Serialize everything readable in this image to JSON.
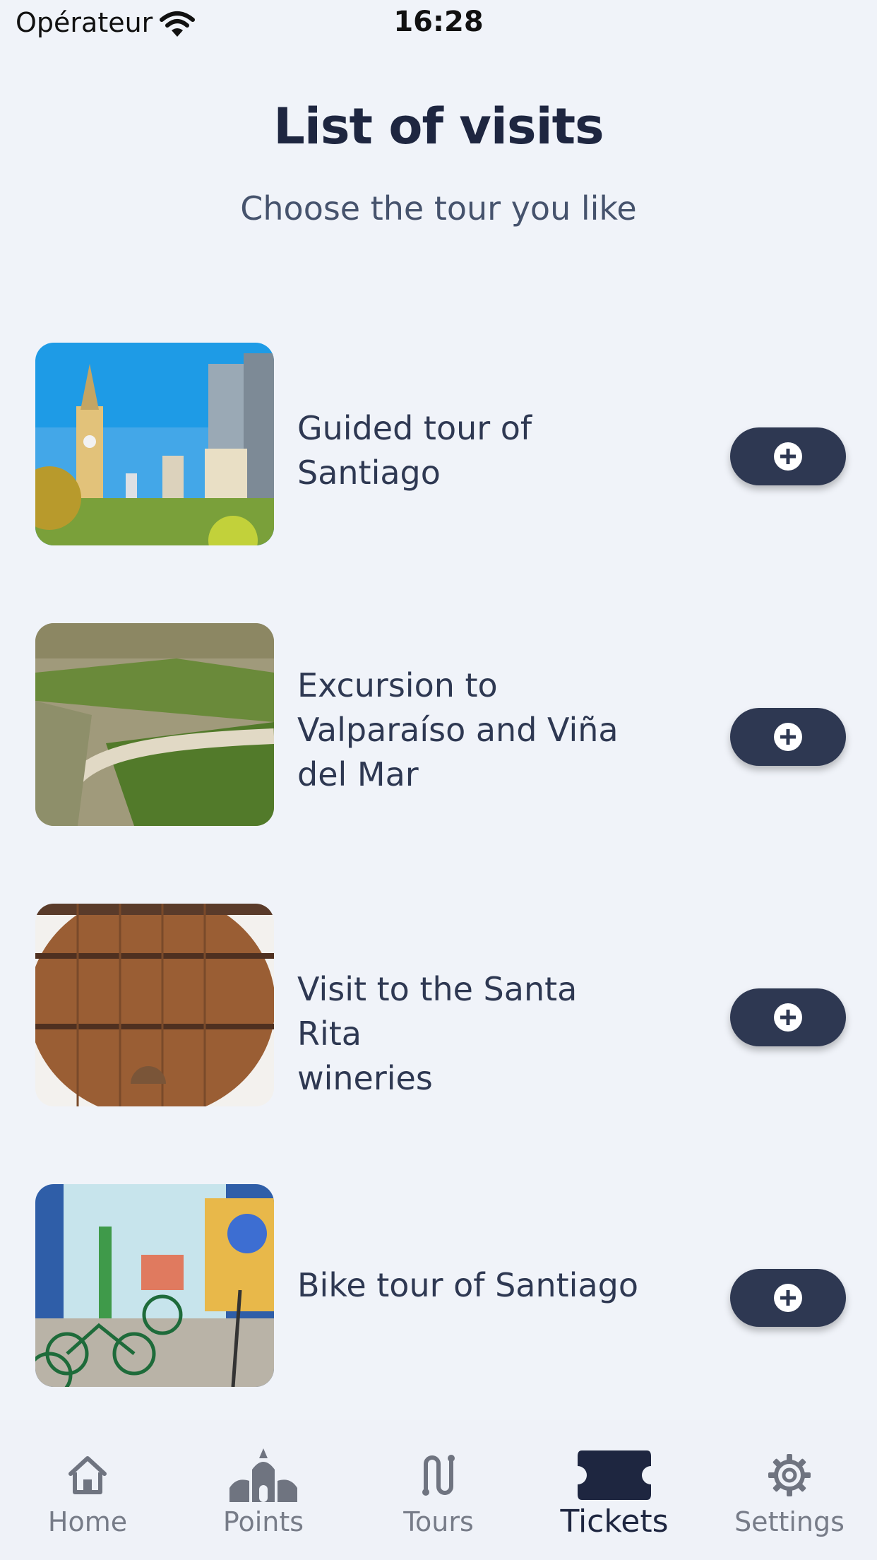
{
  "status_bar": {
    "carrier": "Opérateur",
    "time": "16:28"
  },
  "header": {
    "title": "List of visits",
    "subtitle": "Choose the tour you like"
  },
  "tours": [
    {
      "name_line1": "Guided tour of",
      "name_line2": "Santiago",
      "name_line3": ""
    },
    {
      "name_line1": "Excursion to",
      "name_line2": "Valparaíso and Viña",
      "name_line3": "del Mar"
    },
    {
      "name_line1": "Visit to the Santa Rita",
      "name_line2": "wineries",
      "name_line3": ""
    },
    {
      "name_line1": "Bike tour of Santiago",
      "name_line2": "",
      "name_line3": ""
    }
  ],
  "tab_bar": {
    "active": "Tickets",
    "tabs": [
      {
        "label": "Home",
        "icon": "home-icon"
      },
      {
        "label": "Points",
        "icon": "church-icon"
      },
      {
        "label": "Tours",
        "icon": "route-icon"
      },
      {
        "label": "Tickets",
        "icon": "ticket-icon"
      },
      {
        "label": "Settings",
        "icon": "gear-icon"
      }
    ]
  },
  "colors": {
    "background": "#f0f3f9",
    "button": "#2e3852",
    "text": "#2e3852",
    "inactive_tab": "#777c88"
  }
}
